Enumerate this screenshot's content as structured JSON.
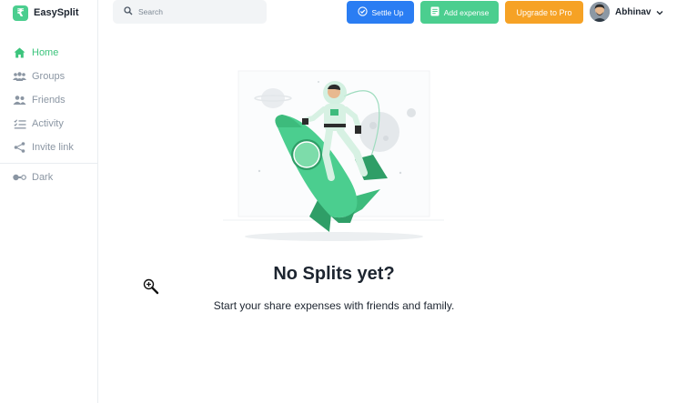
{
  "brand": {
    "logo_char": "₹",
    "name": "EasySplit"
  },
  "sidebar": {
    "items": [
      {
        "label": "Home",
        "icon": "home-icon",
        "active": true
      },
      {
        "label": "Groups",
        "icon": "groups-icon",
        "active": false
      },
      {
        "label": "Friends",
        "icon": "friends-icon",
        "active": false
      },
      {
        "label": "Activity",
        "icon": "activity-icon",
        "active": false
      },
      {
        "label": "Invite link",
        "icon": "share-icon",
        "active": false
      }
    ],
    "theme_toggle": {
      "label": "Dark",
      "icon": "toggle-icon"
    }
  },
  "header": {
    "search": {
      "placeholder": "Search"
    },
    "settle_up_label": "Settle Up",
    "add_expense_label": "Add expense",
    "upgrade_label": "Upgrade to Pro",
    "user_name": "Abhinav"
  },
  "main": {
    "empty_title": "No Splits yet?",
    "empty_subtitle": "Start your share expenses with friends and family."
  },
  "colors": {
    "accent_green": "#4bce8f",
    "primary_blue": "#2a7df3",
    "pro_orange": "#f6a225",
    "text_dark": "#1d2530",
    "muted": "#8b96a3"
  }
}
